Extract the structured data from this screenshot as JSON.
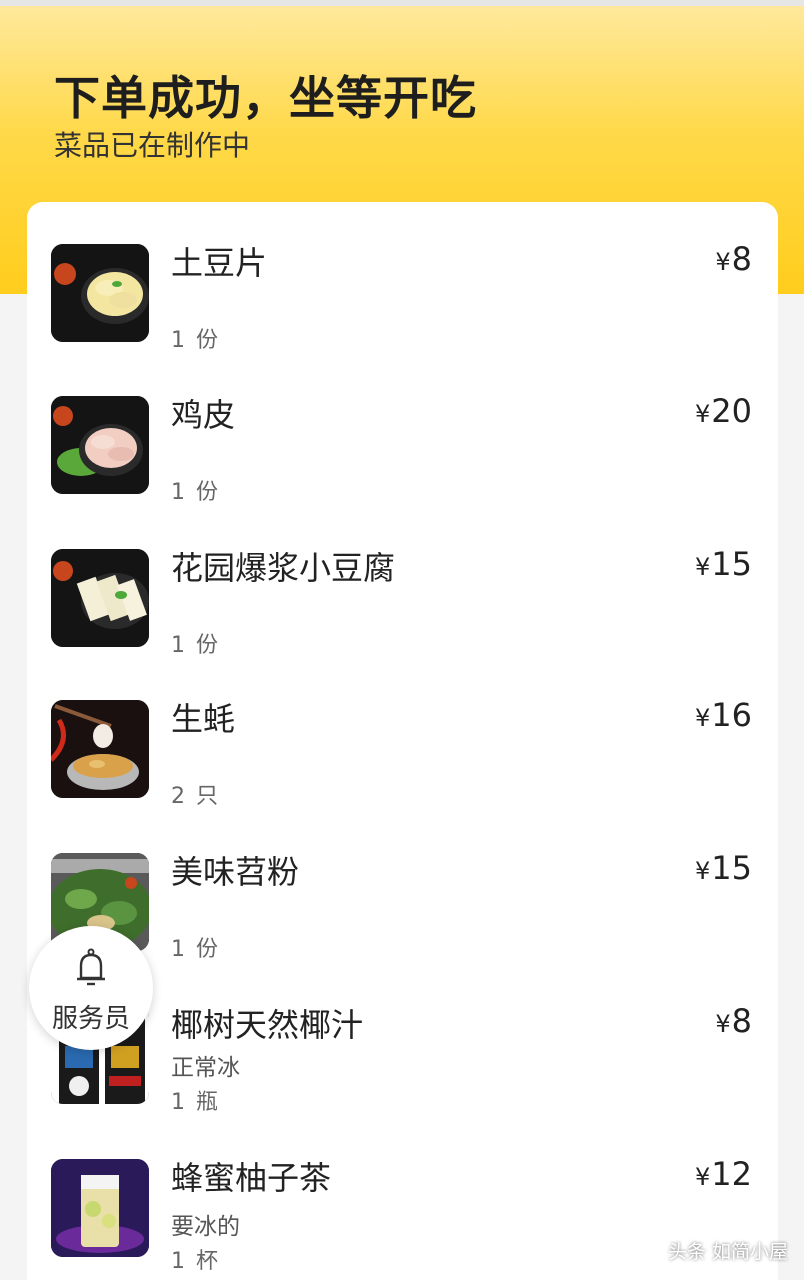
{
  "header": {
    "title": "下单成功，坐等开吃",
    "subtitle": "菜品已在制作中"
  },
  "items": [
    {
      "name": "土豆片",
      "price": "8",
      "qty": "1 份",
      "note": "",
      "icon": "potato-slices"
    },
    {
      "name": "鸡皮",
      "price": "20",
      "qty": "1 份",
      "note": "",
      "icon": "chicken-skin"
    },
    {
      "name": "花园爆浆小豆腐",
      "price": "15",
      "qty": "1 份",
      "note": "",
      "icon": "tofu"
    },
    {
      "name": "生蚝",
      "price": "16",
      "qty": "2 只",
      "note": "",
      "icon": "oyster"
    },
    {
      "name": "美味苕粉",
      "price": "15",
      "qty": "1 份",
      "note": "",
      "icon": "sweet-potato-noodles"
    },
    {
      "name": "椰树天然椰汁",
      "price": "8",
      "qty": "1 瓶",
      "note": "正常冰",
      "icon": "coconut-juice"
    },
    {
      "name": "蜂蜜柚子茶",
      "price": "12",
      "qty": "1 杯",
      "note": "要冰的",
      "icon": "honey-citron-tea"
    }
  ],
  "currency_symbol": "¥",
  "waiter_button": {
    "label": "服务员",
    "icon": "bell-icon"
  },
  "watermark": "头条 如简小屋",
  "colors": {
    "header_top": "#ffe9a0",
    "header_bottom": "#ffcd1c",
    "card": "#ffffff",
    "background": "#f4f4f4"
  }
}
